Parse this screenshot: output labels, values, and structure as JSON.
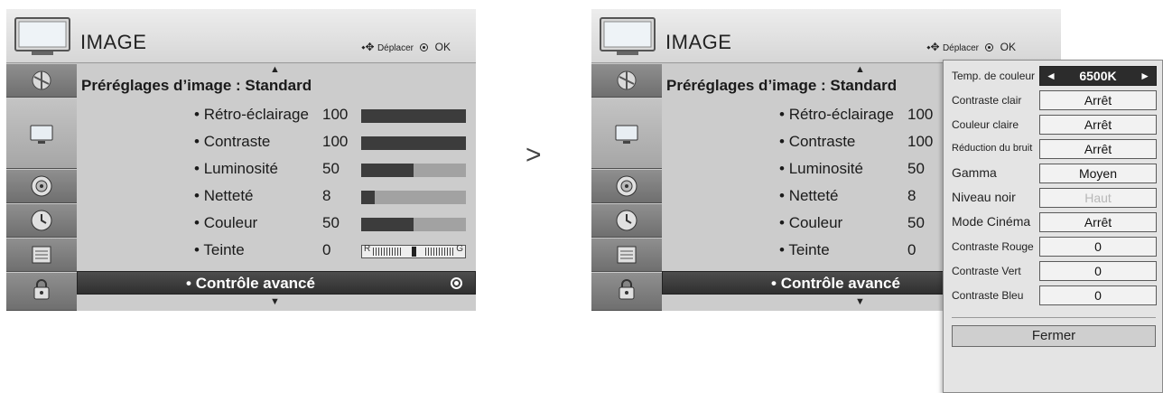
{
  "separator": ">",
  "panel_left": {
    "title": "IMAGE",
    "hint_move": "Déplacer",
    "hint_ok": "OK",
    "preset": "Préréglages d’image : Standard",
    "rows": [
      {
        "label": "Rétro-éclairage",
        "value": "100",
        "level": 1.0
      },
      {
        "label": "Contraste",
        "value": "100",
        "level": 1.0
      },
      {
        "label": "Luminosité",
        "value": "50",
        "level": 0.5
      },
      {
        "label": "Netteté",
        "value": "8",
        "level": 0.13
      },
      {
        "label": "Couleur",
        "value": "50",
        "level": 0.5
      },
      {
        "label": "Teinte",
        "value": "0",
        "tint_left": "R",
        "tint_right": "G"
      }
    ],
    "advanced": "Contrôle avancé"
  },
  "panel_right": {
    "title": "IMAGE",
    "hint_move": "Déplacer",
    "hint_ok": "OK",
    "preset": "Préréglages d’image : Standard",
    "rows": [
      {
        "label": "Rétro-éclairage",
        "value": "100"
      },
      {
        "label": "Contraste",
        "value": "100"
      },
      {
        "label": "Luminosité",
        "value": "50"
      },
      {
        "label": "Netteté",
        "value": "8"
      },
      {
        "label": "Couleur",
        "value": "50"
      },
      {
        "label": "Teinte",
        "value": "0"
      }
    ],
    "advanced": "Contrôle avancé"
  },
  "popup": {
    "rows": [
      {
        "label": "Temp. de couleur",
        "value": "6500K"
      },
      {
        "label": "Contraste clair",
        "value": "Arrêt"
      },
      {
        "label": "Couleur claire",
        "value": "Arrêt"
      },
      {
        "label": "Réduction du bruit",
        "value": "Arrêt"
      },
      {
        "label": "Gamma",
        "value": "Moyen"
      },
      {
        "label": "Niveau noir",
        "value": "Haut"
      },
      {
        "label": "Mode Cinéma",
        "value": "Arrêt"
      },
      {
        "label": "Contraste Rouge",
        "value": "0"
      },
      {
        "label": "Contraste Vert",
        "value": "0"
      },
      {
        "label": "Contraste Bleu",
        "value": "0"
      }
    ],
    "close": "Fermer"
  },
  "sidebar_icons": [
    "picture-icon",
    "tv-screen-icon",
    "speaker-icon",
    "clock-icon",
    "option-icon",
    "lock-icon"
  ]
}
